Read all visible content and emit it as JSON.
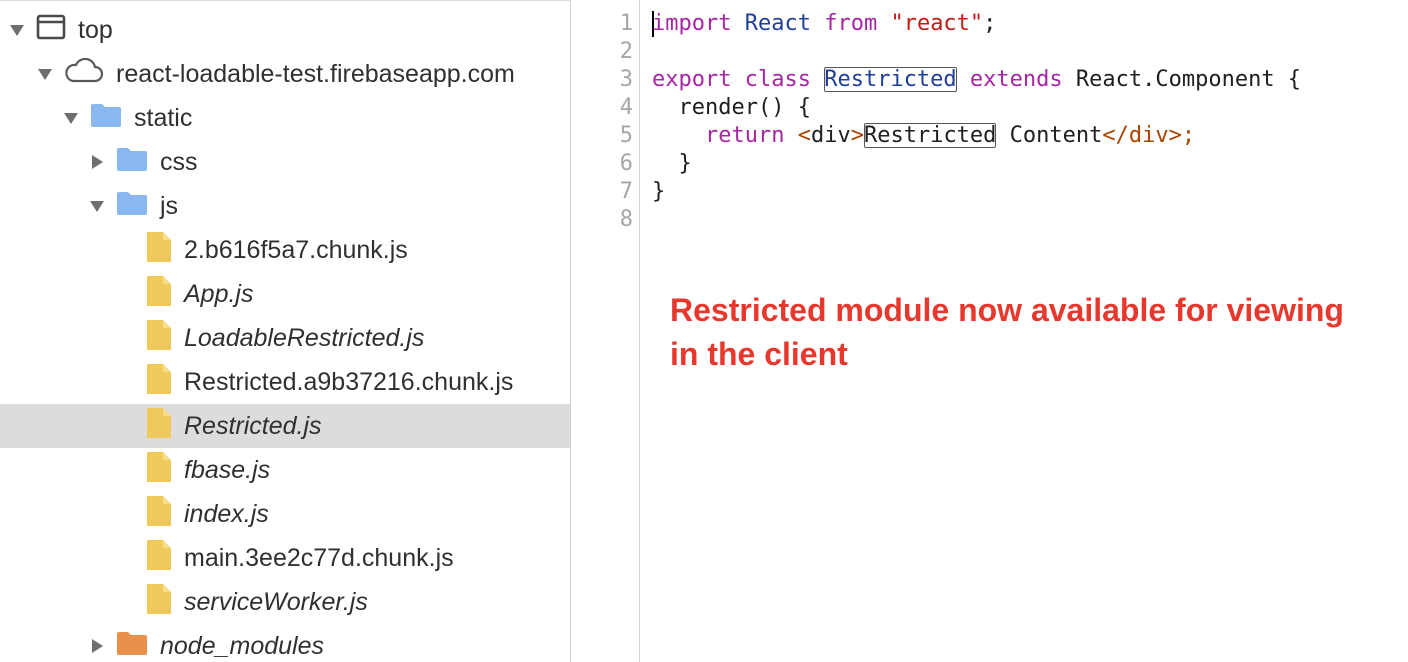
{
  "tree": {
    "items": [
      {
        "label": "top",
        "arrow": "down",
        "icon": "frame-icon",
        "italic": false,
        "indent": 0
      },
      {
        "label": "react-loadable-test.firebaseapp.com",
        "arrow": "down",
        "icon": "cloud-icon",
        "italic": false,
        "indent": 1
      },
      {
        "label": "static",
        "arrow": "down",
        "icon": "folder-icon",
        "italic": false,
        "indent": 2
      },
      {
        "label": "css",
        "arrow": "right",
        "icon": "folder-icon",
        "italic": false,
        "indent": 3
      },
      {
        "label": "js",
        "arrow": "down",
        "icon": "folder-icon",
        "italic": false,
        "indent": 3
      },
      {
        "label": "2.b616f5a7.chunk.js",
        "arrow": "none",
        "icon": "file-icon",
        "italic": false,
        "indent": 4
      },
      {
        "label": "App.js",
        "arrow": "none",
        "icon": "file-icon",
        "italic": true,
        "indent": 4
      },
      {
        "label": "LoadableRestricted.js",
        "arrow": "none",
        "icon": "file-icon",
        "italic": true,
        "indent": 4
      },
      {
        "label": "Restricted.a9b37216.chunk.js",
        "arrow": "none",
        "icon": "file-icon",
        "italic": false,
        "indent": 4
      },
      {
        "label": "Restricted.js",
        "arrow": "none",
        "icon": "file-icon",
        "italic": true,
        "indent": 4,
        "selected": true
      },
      {
        "label": "fbase.js",
        "arrow": "none",
        "icon": "file-icon",
        "italic": true,
        "indent": 4
      },
      {
        "label": "index.js",
        "arrow": "none",
        "icon": "file-icon",
        "italic": true,
        "indent": 4
      },
      {
        "label": "main.3ee2c77d.chunk.js",
        "arrow": "none",
        "icon": "file-icon",
        "italic": false,
        "indent": 4
      },
      {
        "label": "serviceWorker.js",
        "arrow": "none",
        "icon": "file-icon",
        "italic": true,
        "indent": 4
      },
      {
        "label": "node_modules",
        "arrow": "right",
        "icon": "folder-orange-icon",
        "italic": true,
        "indent": 3
      }
    ]
  },
  "editor": {
    "line_numbers": [
      "1",
      "2",
      "3",
      "4",
      "5",
      "6",
      "7",
      "8"
    ],
    "lines": [
      [
        {
          "t": "import",
          "c": "kw"
        },
        {
          "t": " "
        },
        {
          "t": "React",
          "c": "ident"
        },
        {
          "t": " "
        },
        {
          "t": "from",
          "c": "kw"
        },
        {
          "t": " "
        },
        {
          "t": "\"react\"",
          "c": "str"
        },
        {
          "t": ";"
        }
      ],
      [],
      [
        {
          "t": "export",
          "c": "kw"
        },
        {
          "t": " "
        },
        {
          "t": "class",
          "c": "kw"
        },
        {
          "t": " "
        },
        {
          "t": "Restricted",
          "c": "ident boxed"
        },
        {
          "t": " "
        },
        {
          "t": "extends",
          "c": "kw"
        },
        {
          "t": " React.Component {"
        }
      ],
      [
        {
          "t": "  render() {"
        }
      ],
      [
        {
          "t": "    "
        },
        {
          "t": "return",
          "c": "kw"
        },
        {
          "t": " "
        },
        {
          "t": "<",
          "c": "tag"
        },
        {
          "t": "div",
          "c": ""
        },
        {
          "t": ">",
          "c": "tag"
        },
        {
          "t": "Restricted",
          "c": "boxed"
        },
        {
          "t": " Content"
        },
        {
          "t": "</div>",
          "c": "tag"
        },
        {
          "t": ";",
          "c": "tag"
        }
      ],
      [
        {
          "t": "  }"
        }
      ],
      [
        {
          "t": "}"
        }
      ],
      []
    ]
  },
  "annotation": {
    "line1": "Restricted module now available for viewing",
    "line2": "in the client"
  },
  "colors": {
    "annotation": "#e8382d",
    "folder": "#8ab7ee",
    "folder_orange": "#e9914a",
    "file": "#f0c95c",
    "selected_row": "#dcdcdc"
  }
}
